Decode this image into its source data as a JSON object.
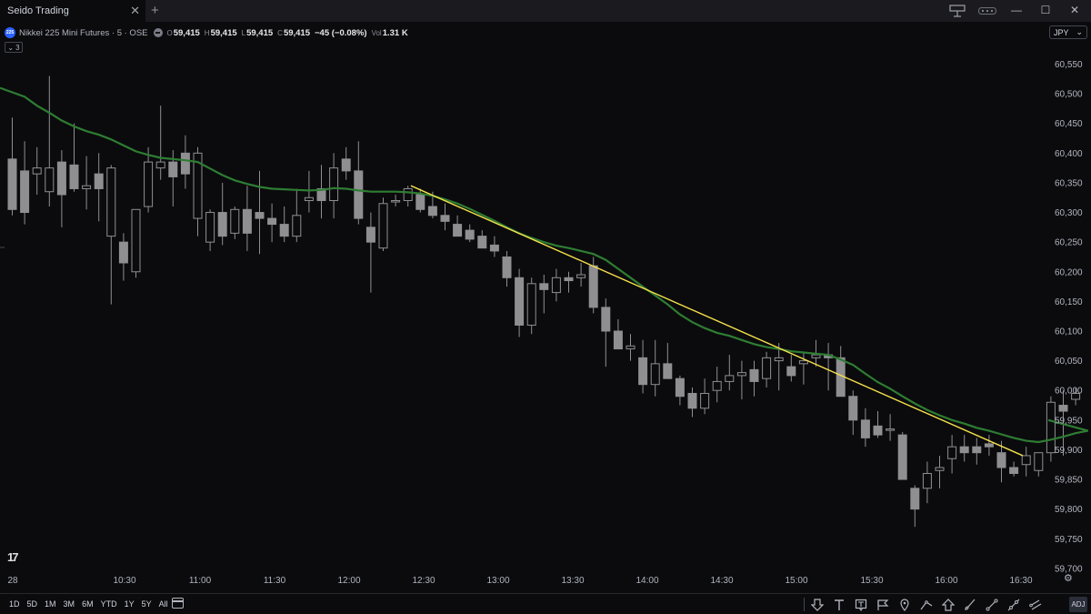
{
  "window": {
    "app_title": "Seido Trading",
    "tab_close_glyph": "✕",
    "new_tab_glyph": "+",
    "window_controls": [
      "—",
      "☐",
      "✕"
    ]
  },
  "legend": {
    "symbol_badge": "225",
    "symbol": "Nikkei 225 Mini Futures · 5 · OSE",
    "ohlc": [
      {
        "label": "O",
        "value": "59,415"
      },
      {
        "label": "H",
        "value": "59,415"
      },
      {
        "label": "L",
        "value": "59,415"
      },
      {
        "label": "C",
        "value": "59,415"
      }
    ],
    "change": "−45 (−0.08%)",
    "volume_label": "Vol",
    "volume_value": "1.31 K",
    "indicator_count": "3",
    "indicator_caret": "⌄"
  },
  "currency": {
    "value": "JPY",
    "caret": "⌄"
  },
  "colors": {
    "background": "#0b0b0e",
    "candle": "#8f8f92",
    "moving_average": "#2e7d32",
    "trendline": "#f7e24a",
    "axis_text": "#b2b5be"
  },
  "chart_data": {
    "type": "candlestick",
    "y_axis_ticks": [
      60550,
      60500,
      60450,
      60400,
      60350,
      60300,
      60250,
      60200,
      60150,
      60100,
      60050,
      60000,
      59950,
      59900,
      59850,
      59800,
      59750,
      59700
    ],
    "y_tick_labels": [
      "60,550",
      "60,500",
      "60,450",
      "60,400",
      "60,350",
      "60,300",
      "60,250",
      "60,200",
      "60,150",
      "60,100",
      "60,050",
      "60,000",
      "59,950",
      "59,900",
      "59,850",
      "59,800",
      "59,750",
      "59,700"
    ],
    "x_tick_labels": [
      "28",
      "10:30",
      "11:00",
      "11:30",
      "12:00",
      "12:30",
      "13:00",
      "13:30",
      "14:00",
      "14:30",
      "15:00",
      "15:30",
      "16:00",
      "16:30"
    ],
    "candles": [
      [
        60390,
        60460,
        60295,
        60305
      ],
      [
        60370,
        60420,
        60280,
        60300
      ],
      [
        60365,
        60410,
        60330,
        60375
      ],
      [
        60335,
        60530,
        60310,
        60375
      ],
      [
        60385,
        60405,
        60275,
        60330
      ],
      [
        60380,
        60450,
        60335,
        60340
      ],
      [
        60340,
        60395,
        60305,
        60345
      ],
      [
        60365,
        60400,
        60285,
        60340
      ],
      [
        60260,
        60380,
        60145,
        60375
      ],
      [
        60250,
        60265,
        60185,
        60215
      ],
      [
        60200,
        60290,
        60190,
        60305
      ],
      [
        60310,
        60410,
        60300,
        60385
      ],
      [
        60375,
        60480,
        60355,
        60385
      ],
      [
        60385,
        60405,
        60310,
        60360
      ],
      [
        60400,
        60430,
        60340,
        60365
      ],
      [
        60290,
        60410,
        60260,
        60400
      ],
      [
        60250,
        60305,
        60235,
        60300
      ],
      [
        60300,
        60350,
        60245,
        60260
      ],
      [
        60265,
        60310,
        60255,
        60305
      ],
      [
        60305,
        60345,
        60235,
        60265
      ],
      [
        60300,
        60370,
        60230,
        60290
      ],
      [
        60290,
        60315,
        60250,
        60280
      ],
      [
        60280,
        60310,
        60250,
        60260
      ],
      [
        60260,
        60340,
        60250,
        60295
      ],
      [
        60320,
        60370,
        60300,
        60325
      ],
      [
        60340,
        60380,
        60290,
        60320
      ],
      [
        60320,
        60400,
        60290,
        60375
      ],
      [
        60390,
        60410,
        60355,
        60370
      ],
      [
        60370,
        60420,
        60280,
        60290
      ],
      [
        60275,
        60300,
        60165,
        60250
      ],
      [
        60240,
        60325,
        60235,
        60315
      ],
      [
        60320,
        60330,
        60310,
        60320
      ],
      [
        60320,
        60345,
        60310,
        60340
      ],
      [
        60330,
        60340,
        60300,
        60305
      ],
      [
        60310,
        60335,
        60290,
        60295
      ],
      [
        60295,
        60315,
        60270,
        60285
      ],
      [
        60280,
        60295,
        60265,
        60260
      ],
      [
        60270,
        60280,
        60250,
        60255
      ],
      [
        60260,
        60270,
        60245,
        60240
      ],
      [
        60245,
        60260,
        60225,
        60235
      ],
      [
        60225,
        60235,
        60175,
        60190
      ],
      [
        60190,
        60205,
        60090,
        60110
      ],
      [
        60110,
        60190,
        60095,
        60180
      ],
      [
        60180,
        60195,
        60130,
        60170
      ],
      [
        60165,
        60205,
        60150,
        60190
      ],
      [
        60190,
        60200,
        60165,
        60185
      ],
      [
        60190,
        60215,
        60175,
        60195
      ],
      [
        60210,
        60225,
        60130,
        60140
      ],
      [
        60140,
        60155,
        60040,
        60100
      ],
      [
        60100,
        60120,
        60070,
        60070
      ],
      [
        60070,
        60095,
        60050,
        60075
      ],
      [
        60055,
        60085,
        59995,
        60010
      ],
      [
        60010,
        60085,
        59990,
        60045
      ],
      [
        60045,
        60080,
        60020,
        60020
      ],
      [
        60020,
        60025,
        59975,
        59990
      ],
      [
        59995,
        60005,
        59955,
        59970
      ],
      [
        59970,
        60020,
        59960,
        59995
      ],
      [
        60000,
        60040,
        59980,
        60015
      ],
      [
        60015,
        60060,
        60000,
        60025
      ],
      [
        60025,
        60050,
        59985,
        60030
      ],
      [
        60035,
        60050,
        59990,
        60015
      ],
      [
        60020,
        60065,
        60005,
        60055
      ],
      [
        60050,
        60080,
        60000,
        60055
      ],
      [
        60040,
        60060,
        60015,
        60025
      ],
      [
        60045,
        60065,
        60010,
        60050
      ],
      [
        60055,
        60085,
        60040,
        60060
      ],
      [
        60060,
        60080,
        60000,
        60055
      ],
      [
        60055,
        60075,
        59990,
        59990
      ],
      [
        59990,
        60000,
        59925,
        59950
      ],
      [
        59950,
        59970,
        59905,
        59920
      ],
      [
        59940,
        59965,
        59920,
        59925
      ],
      [
        59935,
        59960,
        59915,
        59935
      ],
      [
        59925,
        59930,
        59850,
        59850
      ],
      [
        59835,
        59840,
        59770,
        59800
      ],
      [
        59835,
        59880,
        59810,
        59860
      ],
      [
        59865,
        59890,
        59835,
        59870
      ],
      [
        59885,
        59925,
        59860,
        59905
      ],
      [
        59905,
        59925,
        59880,
        59895
      ],
      [
        59905,
        59920,
        59875,
        59895
      ],
      [
        59910,
        59925,
        59890,
        59905
      ],
      [
        59895,
        59915,
        59845,
        59870
      ],
      [
        59870,
        59880,
        59855,
        59860
      ],
      [
        59875,
        59905,
        59855,
        59890
      ],
      [
        59865,
        59890,
        59855,
        59895
      ],
      [
        59895,
        59990,
        59880,
        59980
      ],
      [
        59975,
        60000,
        59890,
        59965
      ],
      [
        59985,
        60005,
        59975,
        59995
      ]
    ],
    "moving_average": [
      60510,
      60495,
      60480,
      60468,
      60455,
      60445,
      60437,
      60431,
      60423,
      60413,
      60403,
      60397,
      60392,
      60390,
      60388,
      60385,
      60374,
      60363,
      60354,
      60348,
      60343,
      60340,
      60339,
      60338,
      60337,
      60338,
      60341,
      60340,
      60337,
      60335,
      60335,
      60335,
      60334,
      60332,
      60328,
      60322,
      60315,
      60306,
      60296,
      60286,
      60275,
      60265,
      60257,
      60250,
      60244,
      60240,
      60235,
      60230,
      60220,
      60205,
      60190,
      60175,
      60160,
      60145,
      60128,
      60115,
      60105,
      60097,
      60092,
      60085,
      60078,
      60073,
      60070,
      60066,
      60064,
      60062,
      60060,
      60052,
      60043,
      60028,
      60014,
      60003,
      59990,
      59978,
      59967,
      59958,
      59950,
      59944,
      59937,
      59932,
      59926,
      59920,
      59915,
      59913,
      59917,
      59922,
      59928,
      59932
    ],
    "trendline": [
      [
        60345,
        59890
      ]
    ],
    "axis_range": {
      "ymin": 59680,
      "ymax": 60580
    }
  },
  "tv_logo": "17",
  "settings_glyph": "⚙",
  "bottom_bar": {
    "ranges": [
      "1D",
      "5D",
      "1M",
      "3M",
      "6M",
      "YTD",
      "1Y",
      "5Y",
      "All"
    ],
    "adj_label": "ADJ"
  }
}
